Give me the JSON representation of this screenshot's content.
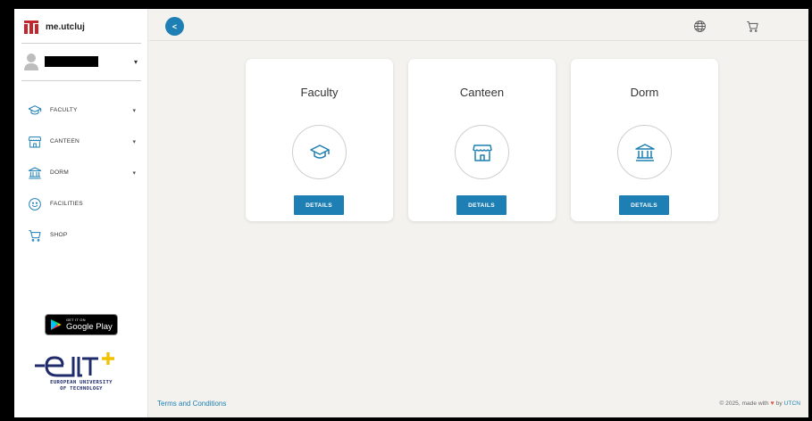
{
  "brand": {
    "name": "me.utcluj",
    "logo_icon": "utcn-logo-icon"
  },
  "user": {
    "avatar_icon": "user-avatar-icon",
    "name_redacted": true,
    "caret": "▾"
  },
  "sidebar": {
    "items": [
      {
        "label": "FACULTY",
        "icon": "graduation-cap-icon",
        "caret": "▾"
      },
      {
        "label": "CANTEEN",
        "icon": "storefront-icon",
        "caret": "▾"
      },
      {
        "label": "DORM",
        "icon": "bank-building-icon",
        "caret": "▾"
      },
      {
        "label": "FACILITIES",
        "icon": "smiley-icon"
      },
      {
        "label": "SHOP",
        "icon": "cart-icon"
      }
    ],
    "google_play": {
      "small": "GET IT ON",
      "main": "Google Play"
    },
    "eut": {
      "caption_line1": "EUROPEAN UNIVERSITY",
      "caption_line2": "OF TECHNOLOGY"
    }
  },
  "topbar": {
    "back_icon": "chevron-left-icon",
    "collapse_glyph": "<",
    "language_icon": "globe-icon",
    "cart_icon": "cart-icon"
  },
  "cards": [
    {
      "title": "Faculty",
      "icon": "graduation-cap-icon",
      "button": "DETAILS"
    },
    {
      "title": "Canteen",
      "icon": "storefront-icon",
      "button": "DETAILS"
    },
    {
      "title": "Dorm",
      "icon": "bank-building-icon",
      "button": "DETAILS"
    }
  ],
  "footer": {
    "terms": "Terms and Conditions",
    "copyright_prefix": "© 2025, made with",
    "heart": "♥",
    "copyright_by": "by",
    "copyright_brand": "UTCN"
  },
  "colors": {
    "accent": "#1d7fb3",
    "background": "#f3f2ef",
    "heart": "#e15a47",
    "eut_blue": "#1f2b6b",
    "eut_yellow": "#f2c200",
    "brand_red": "#c1272d"
  }
}
